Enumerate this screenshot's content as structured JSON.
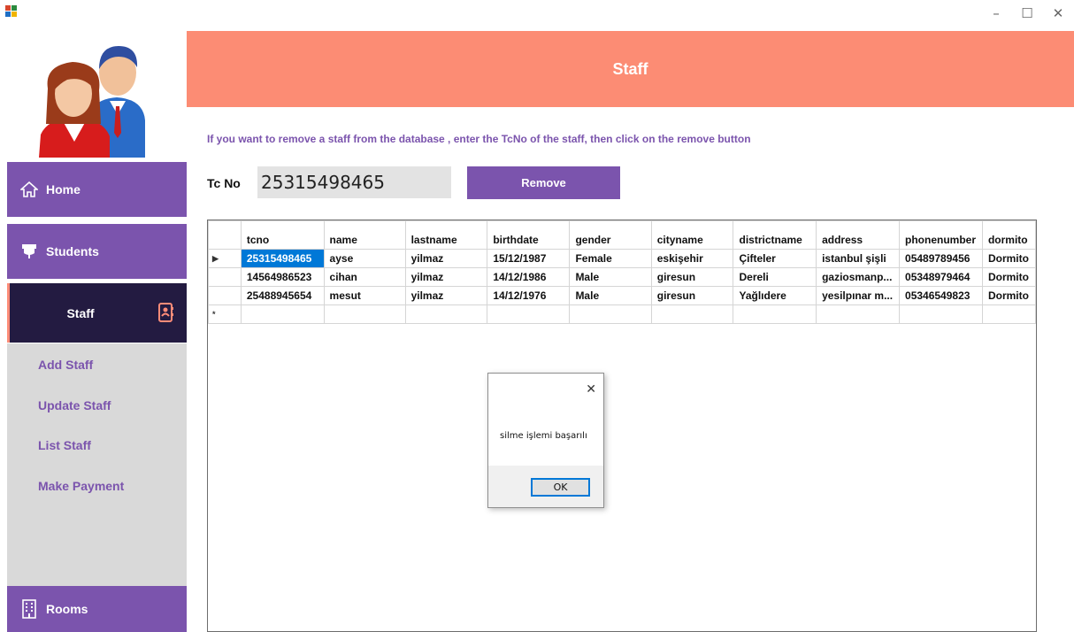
{
  "window": {
    "minimize": "–",
    "maximize": "☐",
    "close": "✕"
  },
  "sidebar": {
    "home": "Home",
    "students": "Students",
    "staff": "Staff",
    "submenu": [
      "Add Staff",
      "Update Staff",
      "List Staff",
      "Make Payment"
    ],
    "rooms": "Rooms"
  },
  "header": {
    "title": "Staff"
  },
  "instruction": "If you want to remove a staff from the database , enter the TcNo of the staff, then click on the remove button",
  "form": {
    "tc_label": "Tc No",
    "tc_value": "25315498465",
    "remove_label": "Remove"
  },
  "grid": {
    "columns": [
      "tcno",
      "name",
      "lastname",
      "birthdate",
      "gender",
      "cityname",
      "districtname",
      "address",
      "phonenumber",
      "dormito"
    ],
    "rows": [
      [
        "25315498465",
        "ayse",
        "yilmaz",
        "15/12/1987",
        "Female",
        "eskişehir",
        "Çifteler",
        "istanbul şişli",
        "05489789456",
        "Dormito"
      ],
      [
        "14564986523",
        "cihan",
        "yilmaz",
        "14/12/1986",
        "Male",
        "giresun",
        "Dereli",
        "gaziosmanp...",
        "05348979464",
        "Dormito"
      ],
      [
        "25488945654",
        "mesut",
        "yilmaz",
        "14/12/1976",
        "Male",
        "giresun",
        "Yağlıdere",
        "yesilpınar m...",
        "05346549823",
        "Dormito"
      ]
    ],
    "current_row_marker": "▶",
    "new_row_marker": "*"
  },
  "dialog": {
    "message": "silme işlemi başarılı",
    "ok_label": "OK",
    "close": "✕"
  },
  "colors": {
    "purple": "#7b54ad",
    "dark": "#231b41",
    "salmon": "#fc8c74",
    "submenu_bg": "#d9d9d9"
  }
}
